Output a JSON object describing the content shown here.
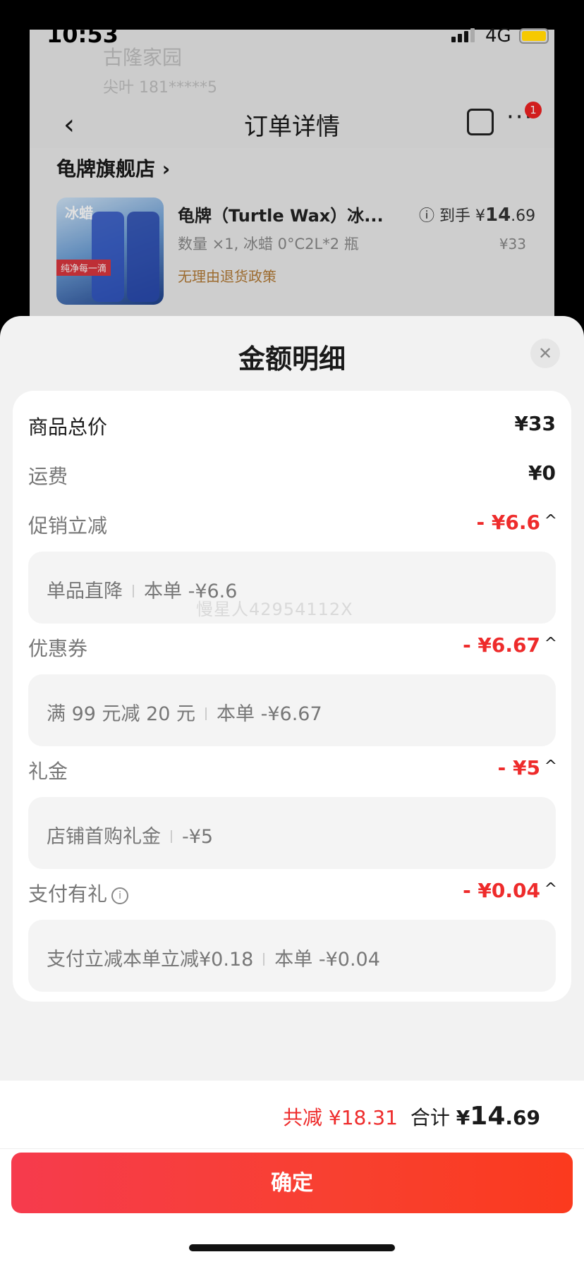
{
  "status_bar": {
    "time": "10:53",
    "network": "4G",
    "battery_color": "#f6c900"
  },
  "background_page": {
    "ghost_address": "古隆家园",
    "ghost_phone": "尖叶 181*****5",
    "nav_title": "订单详情",
    "back_glyph": "‹",
    "more_glyph": "···",
    "badge_count": "1",
    "shop_name": "龟牌旗舰店 ›",
    "product": {
      "thumb_text_1": "冰蜡",
      "thumb_text_2": "纯净每一滴",
      "name": "龟牌（Turtle Wax）冰...",
      "spec": "数量 ×1, 冰蜡 0°C2L*2 瓶",
      "policy": "无理由退货政策",
      "final_label": "ⓘ 到手 ¥",
      "final_int": "14",
      "final_dec": ".69",
      "original_price": "¥33"
    }
  },
  "sheet": {
    "title": "金额明细",
    "close_glyph": "✕",
    "rows": {
      "goods_total": {
        "label": "商品总价",
        "value": "¥33"
      },
      "shipping": {
        "label": "运费",
        "value": "¥0"
      },
      "promotion": {
        "label": "促销立减",
        "value": "- ¥6.6",
        "detail_name": "单品直降",
        "detail_value": "本单 -¥6.6"
      },
      "coupon": {
        "label": "优惠券",
        "value": "- ¥6.67",
        "detail_name": "满 99 元减 20 元",
        "detail_value": "本单 -¥6.67"
      },
      "gift": {
        "label": "礼金",
        "value": "- ¥5",
        "detail_name": "店铺首购礼金",
        "detail_value": "-¥5"
      },
      "payment": {
        "label": "支付有礼",
        "value": "- ¥0.04",
        "detail_name": "支付立减本单立减¥0.18",
        "detail_value": "本单 -¥0.04"
      }
    },
    "chevron_glyph": "^",
    "info_glyph": "i",
    "watermark": "慢星人42954112X"
  },
  "footer": {
    "saved": "共减 ¥18.31",
    "total_label": "合计 ",
    "total_currency": "¥",
    "total_int": "14",
    "total_dec": ".69",
    "confirm_label": "确定"
  },
  "colors": {
    "accent_red": "#ee2b2b",
    "button_gradient_start": "#f63b4d",
    "button_gradient_end": "#fb3a1e"
  }
}
